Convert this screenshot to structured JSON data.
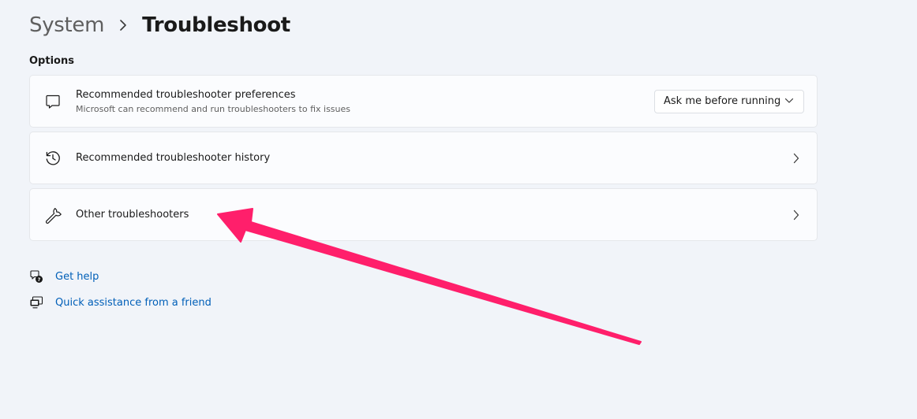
{
  "breadcrumb": {
    "parent": "System",
    "current": "Troubleshoot"
  },
  "section": {
    "label": "Options"
  },
  "cards": [
    {
      "title": "Recommended troubleshooter preferences",
      "description": "Microsoft can recommend and run troubleshooters to fix issues",
      "icon": "chat-bubble-icon",
      "dropdown_value": "Ask me before running"
    },
    {
      "title": "Recommended troubleshooter history",
      "icon": "history-icon"
    },
    {
      "title": "Other troubleshooters",
      "icon": "wrench-icon"
    }
  ],
  "help_links": [
    {
      "label": "Get help",
      "icon": "help-chat-icon"
    },
    {
      "label": "Quick assistance from a friend",
      "icon": "remote-assist-icon"
    }
  ],
  "colors": {
    "background": "#f1f4f9",
    "card": "#fbfcfe",
    "link": "#005fb8",
    "annotation_arrow": "#ff1f6b"
  }
}
